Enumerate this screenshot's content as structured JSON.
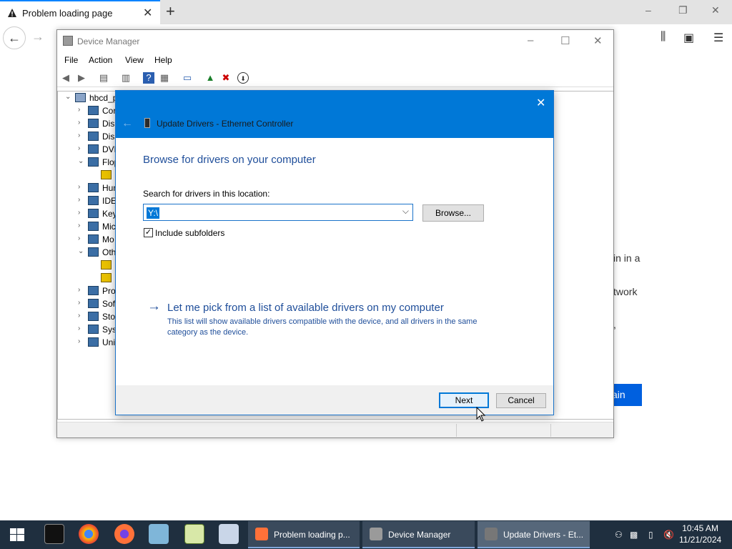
{
  "browser": {
    "tab_title": "Problem loading page",
    "new_tab_label": "+",
    "min_label": "–",
    "restore_label": "❐",
    "close_label": "✕",
    "page_fragments": [
      "in in a",
      "twork",
      ","
    ],
    "try_again_label": "ain"
  },
  "device_manager": {
    "title": "Device Manager",
    "menu": [
      "File",
      "Action",
      "View",
      "Help"
    ],
    "tree": [
      {
        "label": "hbcd_p",
        "expander": "⌄",
        "indent": 0
      },
      {
        "label": "Cor",
        "expander": "›",
        "indent": 1
      },
      {
        "label": "Disl",
        "expander": "›",
        "indent": 1
      },
      {
        "label": "Disp",
        "expander": "›",
        "indent": 1
      },
      {
        "label": "DVD",
        "expander": "›",
        "indent": 1
      },
      {
        "label": "Flop",
        "expander": "⌄",
        "indent": 1
      },
      {
        "label": "",
        "expander": "",
        "indent": 2
      },
      {
        "label": "Hun",
        "expander": "›",
        "indent": 1
      },
      {
        "label": "IDE",
        "expander": "›",
        "indent": 1
      },
      {
        "label": "Key",
        "expander": "›",
        "indent": 1
      },
      {
        "label": "Mic",
        "expander": "›",
        "indent": 1
      },
      {
        "label": "Mo",
        "expander": "›",
        "indent": 1
      },
      {
        "label": "Oth",
        "expander": "⌄",
        "indent": 1
      },
      {
        "label": "",
        "expander": "",
        "indent": 2
      },
      {
        "label": "",
        "expander": "",
        "indent": 2
      },
      {
        "label": "Pro",
        "expander": "›",
        "indent": 1
      },
      {
        "label": "Sof",
        "expander": "›",
        "indent": 1
      },
      {
        "label": "Sto",
        "expander": "›",
        "indent": 1
      },
      {
        "label": "Syst",
        "expander": "›",
        "indent": 1
      },
      {
        "label": "Uni",
        "expander": "›",
        "indent": 1
      }
    ]
  },
  "dialog": {
    "title": "Update Drivers - Ethernet Controller",
    "heading": "Browse for drivers on your computer",
    "search_label": "Search for drivers in this location:",
    "path_value": "Y:\\",
    "browse_label": "Browse...",
    "include_subfolders_label": "Include subfolders",
    "include_subfolders_checked": "✓",
    "pick_link": "Let me pick from a list of available drivers on my computer",
    "pick_desc": "This list will show available drivers compatible with the device, and all drivers in the same category as the device.",
    "next_label": "Next",
    "cancel_label": "Cancel"
  },
  "taskbar": {
    "windows": [
      {
        "label": "Problem loading p...",
        "color": "#ff7139"
      },
      {
        "label": "Device Manager",
        "color": "#9a9a9a"
      },
      {
        "label": "Update Drivers - Et...",
        "color": "#777777"
      }
    ],
    "time": "10:45 AM",
    "date": "11/21/2024"
  }
}
